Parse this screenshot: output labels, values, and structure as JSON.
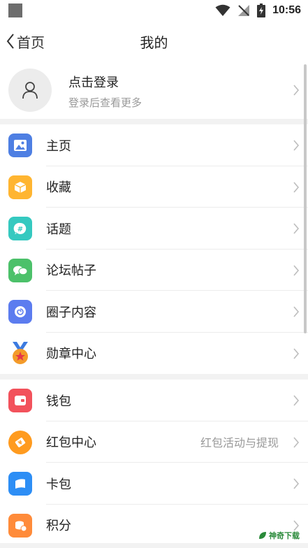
{
  "status": {
    "time": "10:56"
  },
  "nav": {
    "back_label": "首页",
    "title": "我的"
  },
  "profile": {
    "title": "点击登录",
    "subtitle": "登录后查看更多"
  },
  "section1": [
    {
      "label": "主页",
      "icon": "image-icon",
      "color": "#4e7fe3"
    },
    {
      "label": "收藏",
      "icon": "box-icon",
      "color": "#ffb531"
    },
    {
      "label": "话题",
      "icon": "hashtag-chat-icon",
      "color": "#35c9c0"
    },
    {
      "label": "论坛帖子",
      "icon": "chat-bubbles-icon",
      "color": "#4cc16a"
    },
    {
      "label": "圈子内容",
      "icon": "circle-swirl-icon",
      "color": "#5c7cef"
    },
    {
      "label": "勋章中心",
      "icon": "medal-icon",
      "color": "#f39b2a"
    }
  ],
  "section2": [
    {
      "label": "钱包",
      "icon": "wallet-icon",
      "color": "#f2525c",
      "extra": ""
    },
    {
      "label": "红包中心",
      "icon": "red-packet-icon",
      "color": "#ff9b1f",
      "extra": "红包活动与提现"
    },
    {
      "label": "卡包",
      "icon": "card-icon",
      "color": "#2d8ef5",
      "extra": ""
    },
    {
      "label": "积分",
      "icon": "coins-icon",
      "color": "#ff8b3a",
      "extra": ""
    }
  ],
  "watermark": {
    "text": "神奇下载"
  }
}
